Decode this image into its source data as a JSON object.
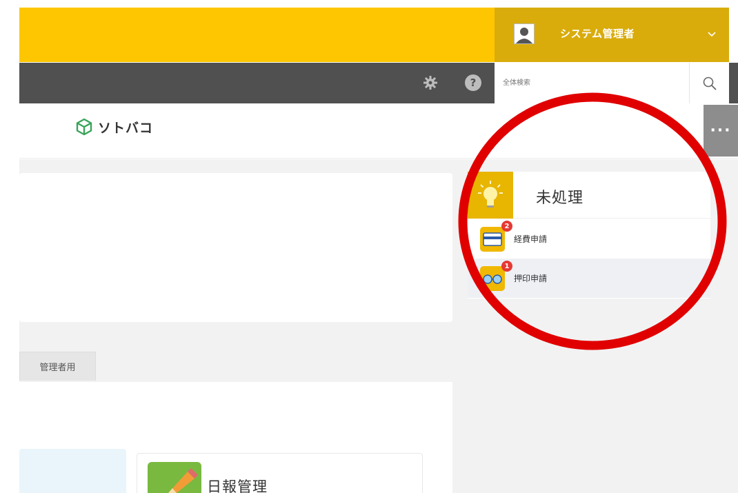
{
  "header": {
    "user_name": "システム管理者",
    "search_placeholder": "全体検索",
    "help_label": "?",
    "more_label": "···"
  },
  "logo": {
    "text": "ソトバコ"
  },
  "tabs": {
    "admin_label": "管理者用"
  },
  "apps": [
    {
      "label": "日報管理",
      "icon": "pencil-icon",
      "color": "#79b940"
    }
  ],
  "pending": {
    "title": "未処理",
    "items": [
      {
        "label": "経費申請",
        "badge": "2",
        "icon": "card-icon"
      },
      {
        "label": "押印申請",
        "badge": "1",
        "icon": "glasses-icon"
      }
    ]
  },
  "colors": {
    "topbar": "#fdc600",
    "user_menu": "#d9ac0c",
    "toolbar": "#505050",
    "annotation_ring": "#e00000",
    "badge": "#e53935"
  }
}
